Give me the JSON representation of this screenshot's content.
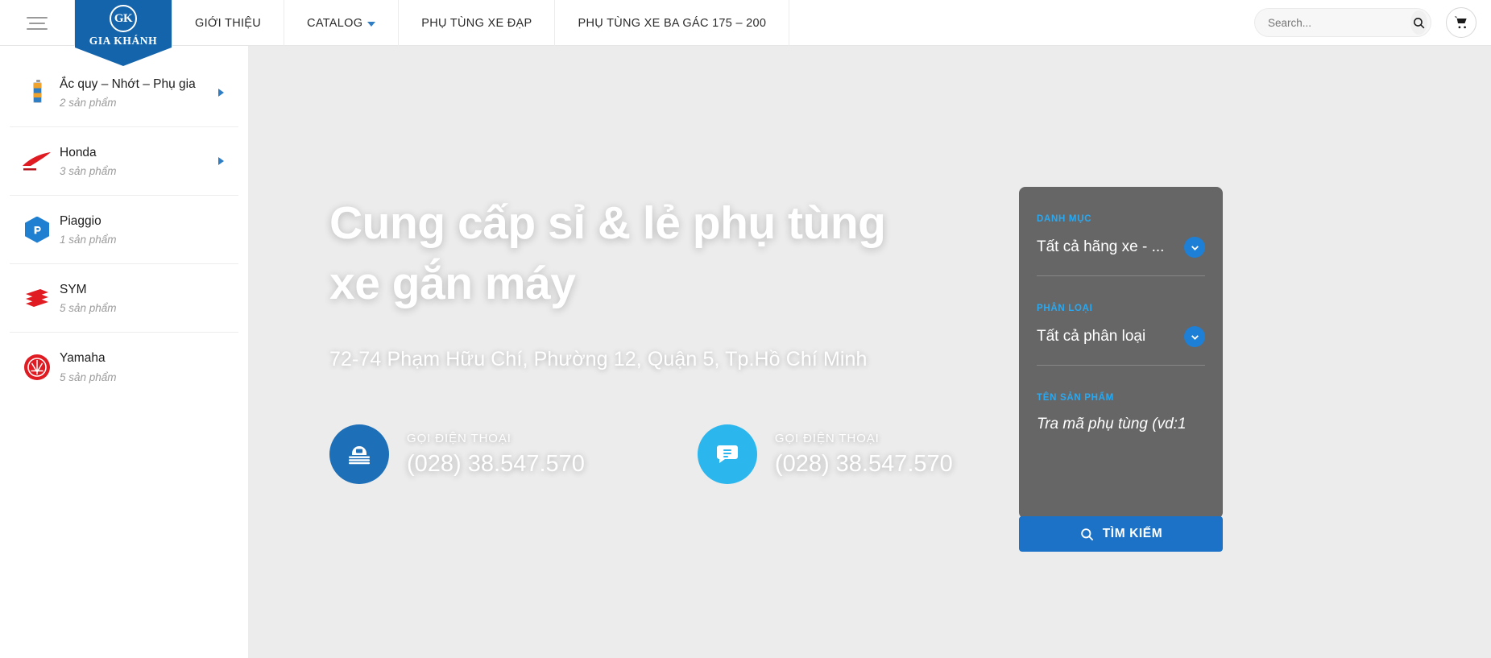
{
  "header": {
    "menu_icon": "hamburger-icon",
    "logo": {
      "mark": "GK",
      "name": "GIA KHÁNH"
    },
    "nav": [
      {
        "label": "GIỚI THIỆU",
        "has_caret": false
      },
      {
        "label": "CATALOG",
        "has_caret": true
      },
      {
        "label": "PHỤ TÙNG XE ĐẠP",
        "has_caret": false
      },
      {
        "label": "PHỤ TÙNG XE BA GÁC 175 – 200",
        "has_caret": false
      }
    ],
    "search": {
      "value": "",
      "placeholder": "Search..."
    },
    "cart_icon": "shopping-cart-icon"
  },
  "sidebar": {
    "items": [
      {
        "title": "Ắc quy – Nhớt – Phụ gia",
        "count": "2 sản phẩm",
        "icon": "battery-icon",
        "has_arrow": true
      },
      {
        "title": "Honda",
        "count": "3 sản phẩm",
        "icon": "honda-wing-icon",
        "has_arrow": true
      },
      {
        "title": "Piaggio",
        "count": "1 sản phẩm",
        "icon": "piaggio-icon",
        "has_arrow": false
      },
      {
        "title": "SYM",
        "count": "5 sản phẩm",
        "icon": "sym-icon",
        "has_arrow": false
      },
      {
        "title": "Yamaha",
        "count": "5 sản phẩm",
        "icon": "yamaha-tuning-fork-icon",
        "has_arrow": false
      }
    ]
  },
  "hero": {
    "title_line1": "Cung cấp sỉ & lẻ phụ tùng",
    "title_line2": "xe gắn máy",
    "address": "72-74 Phạm Hữu Chí, Phường 12, Quận 5, Tp.Hồ Chí Minh",
    "contacts": [
      {
        "icon": "telephone-icon",
        "label": "GỌI ĐIỆN THOẠI",
        "number": "(028) 38.547.570",
        "color": "#1d6fb8"
      },
      {
        "icon": "chat-bubble-icon",
        "label": "GỌI ĐIỆN THOẠI",
        "number": "(028) 38.547.570",
        "color": "#2bb6ee"
      }
    ]
  },
  "search_panel": {
    "fields": [
      {
        "label": "DANH MỤC",
        "value": "Tất cả hãng xe - ...",
        "type": "select"
      },
      {
        "label": "PHÂN LOẠI",
        "value": "Tất cả phân loại",
        "type": "select"
      },
      {
        "label": "TÊN SẢN PHẨM",
        "value": "Tra mã phụ tùng (vd:1",
        "type": "text-placeholder"
      }
    ],
    "submit_label": "TÌM KIẾM",
    "submit_icon": "search-icon"
  },
  "colors": {
    "brand_blue": "#1464ab",
    "accent_blue": "#1d7fd6",
    "label_blue": "#29a9f2",
    "panel_bg": "rgba(72,72,72,0.82)"
  }
}
